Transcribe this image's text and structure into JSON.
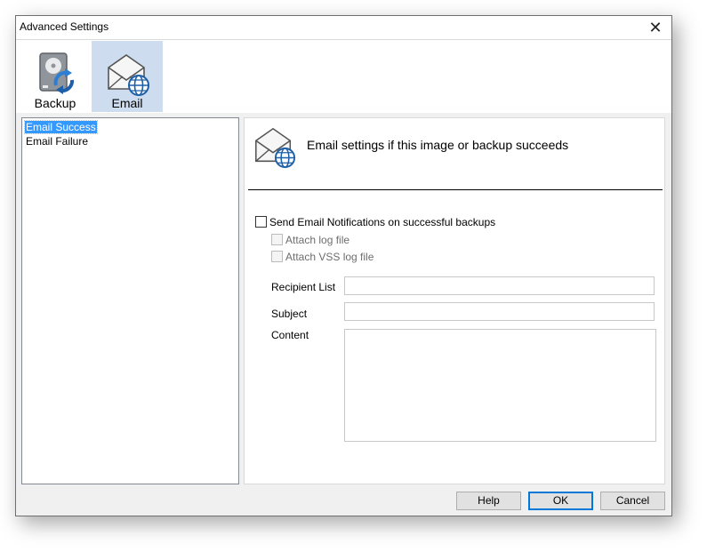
{
  "window": {
    "title": "Advanced Settings",
    "close_glyph": "✕"
  },
  "toolbar": {
    "items": [
      {
        "label": "Backup",
        "icon": "backup-drive-icon",
        "selected": false
      },
      {
        "label": "Email",
        "icon": "email-globe-icon",
        "selected": true
      }
    ]
  },
  "tree": {
    "items": [
      {
        "label": "Email Success",
        "selected": true
      },
      {
        "label": "Email Failure",
        "selected": false
      }
    ]
  },
  "panel": {
    "heading": "Email settings if this image or backup succeeds",
    "icon": "email-globe-icon",
    "send_checkbox": {
      "label": "Send Email Notifications on successful backups",
      "checked": false
    },
    "attach_log": {
      "label": "Attach log file",
      "checked": false,
      "enabled": false
    },
    "attach_vss": {
      "label": "Attach VSS log file",
      "checked": false,
      "enabled": false
    },
    "recipient": {
      "label": "Recipient List",
      "value": ""
    },
    "subject": {
      "label": "Subject",
      "value": ""
    },
    "content": {
      "label": "Content",
      "value": ""
    }
  },
  "buttons": {
    "help": "Help",
    "ok": "OK",
    "cancel": "Cancel"
  },
  "colors": {
    "selected_tool_bg": "#cddcef",
    "tree_selection": "#3399ff",
    "default_button_border": "#0078d7"
  }
}
